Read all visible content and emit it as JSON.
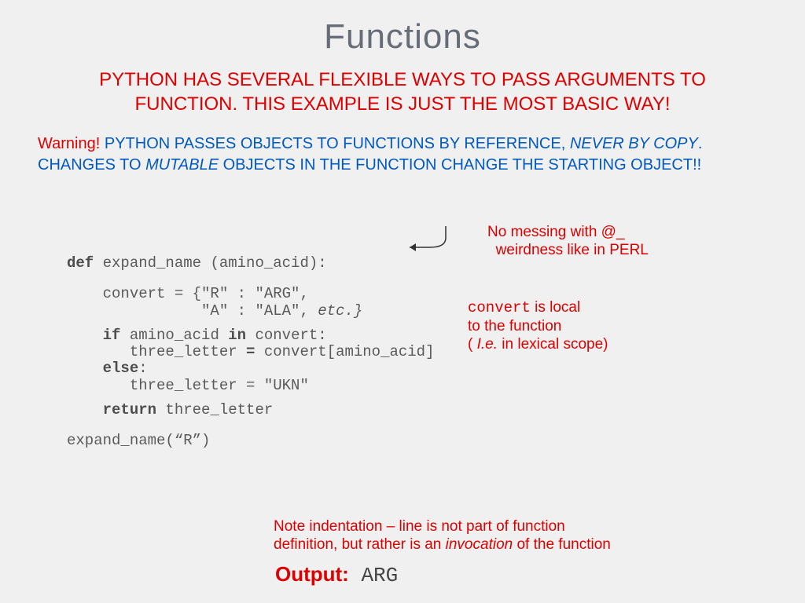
{
  "title": "Functions",
  "subtitle": "PYTHON HAS SEVERAL FLEXIBLE WAYS TO PASS ARGUMENTS TO FUNCTION. THIS EXAMPLE IS JUST THE MOST BASIC WAY!",
  "warning": {
    "warn_label": "Warning!",
    "line1a": " PYTHON PASSES OBJECTS TO FUNCTIONS BY REFERENCE, ",
    "never": "NEVER BY COPY",
    "line1b": ". ",
    "line2a": "CHANGES TO ",
    "mutable": "MUTABLE",
    "line2b": " OBJECTS IN THE FUNCTION CHANGE THE STARTING OBJECT!!"
  },
  "annot_perl": {
    "l1": "No messing with @_",
    "l2": "weirdness like in PERL"
  },
  "annot_convert": {
    "mono": "convert",
    "t1": " is local",
    "l2": "to the function",
    "l3a": "( ",
    "ie": "I.e.",
    "l3b": " in lexical scope)"
  },
  "annot_note": {
    "l1": "Note indentation – line is not part of function",
    "l2a": "definition, but rather is an ",
    "inv": "invocation",
    "l2b": " of the function"
  },
  "code": {
    "l1_def": "def",
    "l1_rest": " expand_name (amino_acid):",
    "l2a": "    convert = {\"R\" : \"ARG\",",
    "l2b": "               \"A\" : \"ALA\", ",
    "l2c": "etc.}",
    "l3_if": "    if",
    "l3a": " amino_acid ",
    "l3_in": "in",
    "l3b": " convert:",
    "l4a": "       three_letter ",
    "l4_eq": "=",
    "l4b": " convert[amino_acid]",
    "l5_else": "    else",
    "l5a": ":",
    "l6": "       three_letter = \"UKN\"",
    "l7_ret": "    return",
    "l7a": " three_letter",
    "l8": "expand_name(“R”)"
  },
  "output": {
    "label": "Output:",
    "value": " ARG"
  }
}
